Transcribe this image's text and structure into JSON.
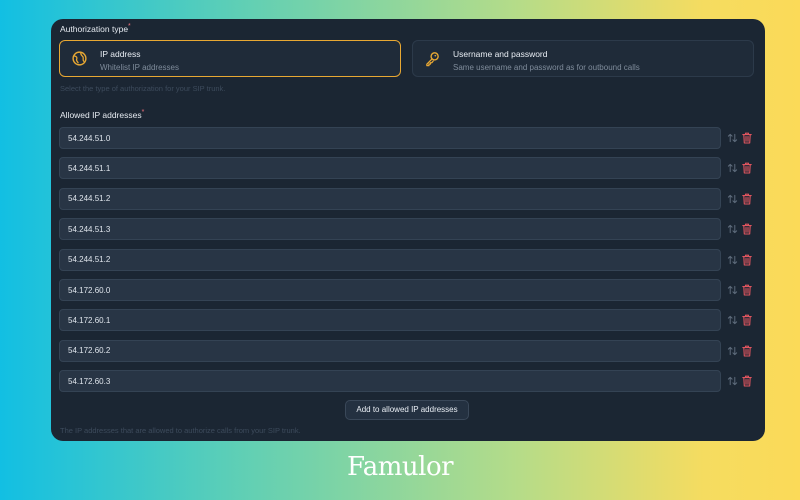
{
  "auth": {
    "label": "Authorization type",
    "required_mark": "*",
    "options": [
      {
        "title": "IP address",
        "description": "Whitelist IP addresses",
        "icon": "globe-icon",
        "selected": true
      },
      {
        "title": "Username and password",
        "description": "Same username and password as for outbound calls",
        "icon": "key-icon",
        "selected": false
      }
    ],
    "helper": "Select the type of authorization for your SIP trunk."
  },
  "allowed_ips": {
    "label": "Allowed IP addresses",
    "required_mark": "*",
    "items": [
      "54.244.51.0",
      "54.244.51.1",
      "54.244.51.2",
      "54.244.51.3",
      "54.244.51.2",
      "54.172.60.0",
      "54.172.60.1",
      "54.172.60.2",
      "54.172.60.3"
    ],
    "add_button": "Add to allowed IP addresses",
    "helper": "The IP addresses that are allowed to authorize calls from your SIP trunk."
  },
  "brand": "Famulor",
  "colors": {
    "accent": "#e8a833",
    "danger": "#e0555f",
    "panel": "#1b2633"
  }
}
